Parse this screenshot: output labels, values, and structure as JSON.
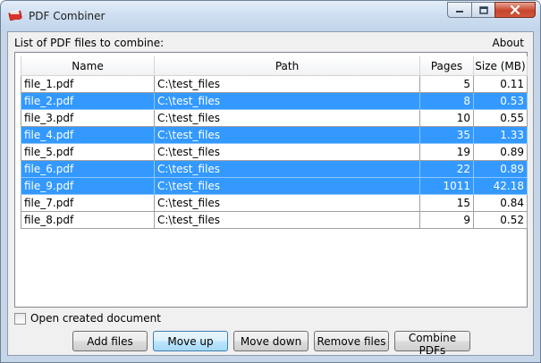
{
  "window": {
    "title": "PDF Combiner"
  },
  "header": {
    "list_label": "List of PDF files to combine:",
    "about_link": "About"
  },
  "table": {
    "columns": [
      "Name",
      "Path",
      "Pages",
      "Size (MB)"
    ],
    "rows": [
      {
        "name": "file_1.pdf",
        "path": "C:\\test_files",
        "pages": "5",
        "size": "0.11",
        "selected": false
      },
      {
        "name": "file_2.pdf",
        "path": "C:\\test_files",
        "pages": "8",
        "size": "0.53",
        "selected": true
      },
      {
        "name": "file_3.pdf",
        "path": "C:\\test_files",
        "pages": "10",
        "size": "0.55",
        "selected": false
      },
      {
        "name": "file_4.pdf",
        "path": "C:\\test_files",
        "pages": "35",
        "size": "1.33",
        "selected": true
      },
      {
        "name": "file_5.pdf",
        "path": "C:\\test_files",
        "pages": "19",
        "size": "0.89",
        "selected": false
      },
      {
        "name": "file_6.pdf",
        "path": "C:\\test_files",
        "pages": "22",
        "size": "0.89",
        "selected": true
      },
      {
        "name": "file_9.pdf",
        "path": "C:\\test_files",
        "pages": "1011",
        "size": "42.18",
        "selected": true
      },
      {
        "name": "file_7.pdf",
        "path": "C:\\test_files",
        "pages": "15",
        "size": "0.84",
        "selected": false
      },
      {
        "name": "file_8.pdf",
        "path": "C:\\test_files",
        "pages": "9",
        "size": "0.52",
        "selected": false
      }
    ]
  },
  "options": {
    "open_created_label": "Open created document",
    "open_created_checked": false
  },
  "buttons": {
    "add": "Add files",
    "move_up": "Move up",
    "move_down": "Move down",
    "remove": "Remove files",
    "combine": "Combine PDFs"
  },
  "colors": {
    "selection": "#3399ff",
    "title_bar": "#c6d6e8",
    "close_button": "#c7452c"
  }
}
